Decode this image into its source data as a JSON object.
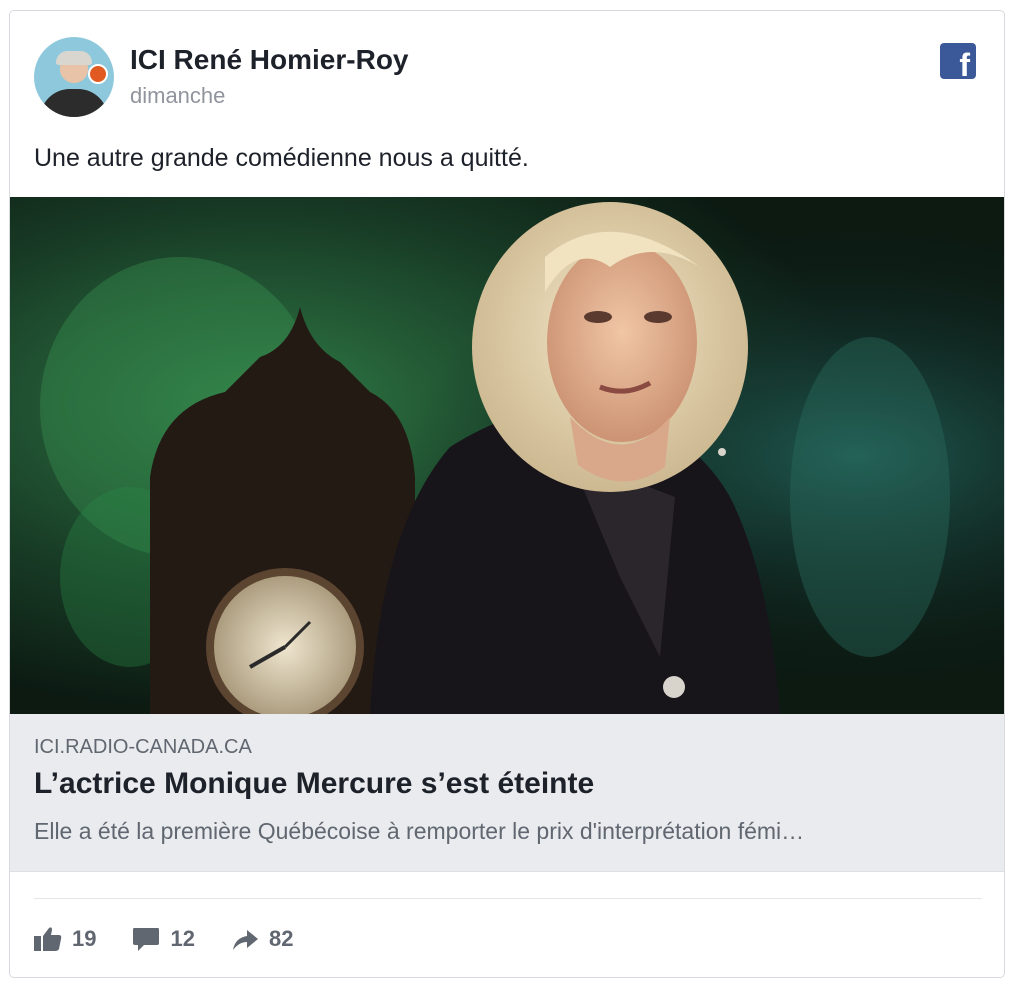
{
  "post": {
    "author": "ICI René Homier-Roy",
    "time": "dimanche",
    "message": "Une autre grande comédienne nous a quitté."
  },
  "link": {
    "domain": "ICI.RADIO-CANADA.CA",
    "title": "L’actrice Monique Mercure s’est éteinte",
    "description": "Elle a été la première Québécoise à remporter le prix d'interprétation fémi…"
  },
  "stats": {
    "likes": "19",
    "comments": "12",
    "shares": "82"
  },
  "icons": {
    "brand": "facebook-icon",
    "like": "thumbs-up-icon",
    "comment": "comment-bubble-icon",
    "share": "share-arrow-icon"
  },
  "colors": {
    "facebook_blue": "#3b5998",
    "link_bg": "#e9ebee",
    "muted_text": "#606770"
  }
}
